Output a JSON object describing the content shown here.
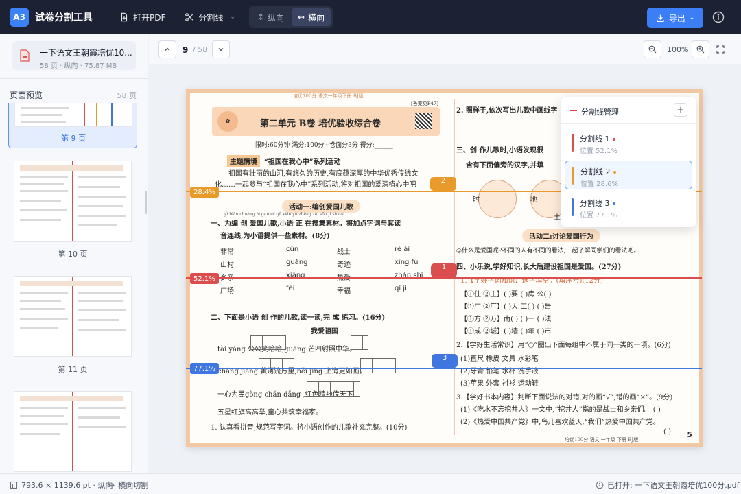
{
  "app": {
    "logo": "A3",
    "title": "试卷分割工具"
  },
  "toolbar": {
    "open_pdf": "打开PDF",
    "split_lines": "分割线",
    "vertical": "纵向",
    "horizontal": "横向",
    "export": "导出",
    "active_mode": "horizontal"
  },
  "sidebar": {
    "file_name": "一下语文王朝霞培优10...",
    "file_meta": "58 页 · 纵向 · 75.87 MB",
    "preview_title": "页面预览",
    "preview_count": "58 页",
    "thumbs": [
      {
        "label": "第 9 页",
        "selected": true
      },
      {
        "label": "第 10 页",
        "selected": false
      },
      {
        "label": "第 11 页",
        "selected": false
      },
      {
        "label": "",
        "selected": false
      }
    ]
  },
  "nav": {
    "current_page": "9",
    "total_pages": "/ 58",
    "zoom": "100%"
  },
  "page": {
    "header_small": "培优100分 语文一年级下册 BJ版",
    "answer_note": "[答案见P47]",
    "unit_title": "第二单元  B卷  培优验收综合卷",
    "meta_line": "限时:60分钟  满分:100分+卷面分3分  得分:______",
    "theme_tag": "主题情境",
    "theme_title": "“祖国在我心中”系列活动",
    "intro_1": "祖国有壮丽的山河,有悠久的历史,有底蕴深厚的中华优秀传统文",
    "intro_2": "化……一起参与“祖国在我心中”系列活动,将对祖国的爱深植心中吧",
    "activity_1": "活动一:编创爱国儿歌",
    "q1_pinyin": "yì biān chuàng ài guó ér gē  xiǎo yǔ zhèng zài sōu jí sù cái",
    "q1": "一、为编 创 爱国儿歌,小语 正 在搜集素材。将加点字词与其读",
    "q1b": "音连线,为小语提供一些素材。(8分)",
    "words_left": [
      "非常",
      "山村",
      "乡亲",
      "广场"
    ],
    "words_mid": [
      "cūn",
      "guǎng",
      "xiāng",
      "fēi"
    ],
    "words_right": [
      "战士",
      "奇迹",
      "热爱",
      "幸福"
    ],
    "words_far": [
      "rè ài",
      "xīng fú",
      "zhàn shì",
      "qí jì"
    ],
    "q2": "二、下面是小语 创 作的儿歌,读一读,完 成 练习。(16分)",
    "poem_title": "我爱祖国",
    "poem_1": "tài yáng        公公笑哈哈,guāng        芒四射照中华。",
    "poem_2": "cháng jiāng        黄河流万里,běi jīng        上海更如画。",
    "poem_3": "一心为民gòng chǎn dǎng            ,红色精神传天下。",
    "poem_4": "五星红旗高高举,童心共筑幸福家。",
    "q2_1": "1. 认真看拼音,规范写字词。将小语创作的儿歌补充完整。(10分)",
    "r_q2": "2. 照样子,依次写出儿歌中画线字",
    "r_q3": "三、创 作儿歌时,小语发现很",
    "r_q3b": "含有下面偏旁的汉字,并填",
    "r_chars": [
      "时",
      "地",
      "土"
    ],
    "activity_2": "活动二:讨论爱国行为",
    "r_intro": "◎什么是爱国呢?不同的人有不同的看法,一起了解同学们的看法吧。",
    "r_q4": "四、小乐说,学好知识,长大后建设祖国是爱国。(27分)",
    "r_q4_1": "1.【学好字词知识】选字填空。(填序号)(12分)",
    "r_rows": [
      "【①住 ②主】(  )要       (  )房       公(  )",
      "【①广 ②厂】(  )大       工(  )       (  )告",
      "【①方 ②万】南(  )       (  )一       (  )法",
      "【①成 ②城】(  )墙       (  )年       (  )市"
    ],
    "r_q4_2": "2.【学好生活常识】用“○”圈出下面每组中不属于同一类的一项。(6分)",
    "r_groups": [
      "(1)直尺      橡皮      文具      水彩笔",
      "(2)牙膏      铅笔      水杯      洗手液",
      "(3)苹果      外套      衬衫      运动鞋"
    ],
    "r_q4_3": "3.【学好书本内容】判断下面说法的对错,对的画“√”,错的画“×”。(9分)",
    "r_j1": "(1)《吃水不忘挖井人》一文中,“挖井人”指的是战士和乡亲们。   (  )",
    "r_j2": "(2)《热爱中国共产党》中,鸟儿喜欢蓝天,“我们”热爱中国共产党。",
    "r_j3": "(  )",
    "footer_small": "培优100分 语文 一年级 下册 BJ版",
    "page_number": "5"
  },
  "split_lines": [
    {
      "id": "1",
      "name": "分割线 1",
      "position_label": "位置 52.1%",
      "position_pct": 52.1,
      "color": "#dc4d4d"
    },
    {
      "id": "2",
      "name": "分割线 2",
      "position_label": "位置 28.6%",
      "position_pct": 28.4,
      "color": "#e89a2a"
    },
    {
      "id": "3",
      "name": "分割线 3",
      "position_label": "位置 77.1%",
      "position_pct": 77.1,
      "color": "#3f76e0"
    }
  ],
  "split_badges": [
    "28.4%",
    "52.1%",
    "77.1%"
  ],
  "panel": {
    "title": "分割线管理",
    "add": "+",
    "active": "2"
  },
  "status": {
    "page_size": "793.6 × 1139.6 pt · 纵向",
    "mode": "横向切割",
    "opened": "已打开: 一下语文王朝霞培优100分.pdf"
  }
}
